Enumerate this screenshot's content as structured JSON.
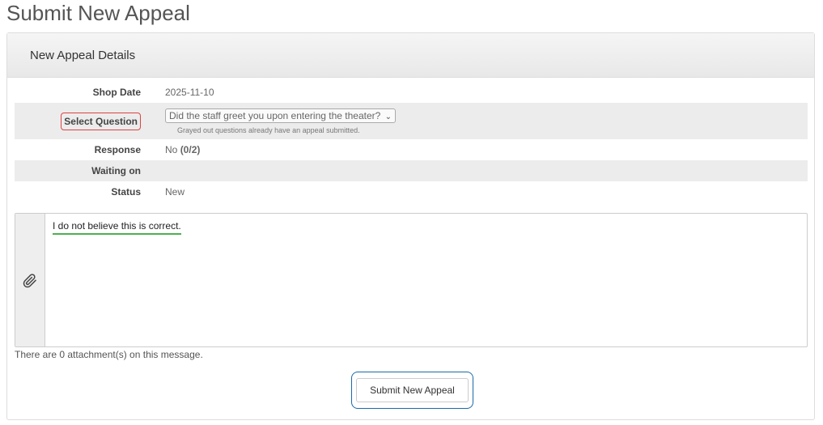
{
  "page": {
    "title": "Submit New Appeal"
  },
  "panel": {
    "heading": "New Appeal Details"
  },
  "details": {
    "shop_date": {
      "label": "Shop Date",
      "value": "2025-11-10"
    },
    "question": {
      "label": "Select Question",
      "selected": "Did the staff greet you upon entering the theater?",
      "help": "Grayed out questions already have an appeal submitted."
    },
    "response": {
      "label": "Response",
      "value": "No",
      "score": "(0/2)"
    },
    "waiting_on": {
      "label": "Waiting on",
      "value": ""
    },
    "status": {
      "label": "Status",
      "value": "New"
    }
  },
  "message": {
    "text": "I do not believe this is correct.",
    "attachment_note": "There are 0 attachment(s) on this message.",
    "attach_icon": "paperclip-icon"
  },
  "actions": {
    "submit_label": "Submit New Appeal"
  },
  "colors": {
    "highlight_red": "#d44444",
    "highlight_blue": "#1a6aa8",
    "underline_green": "#4caf50",
    "stripe": "#ececec"
  }
}
